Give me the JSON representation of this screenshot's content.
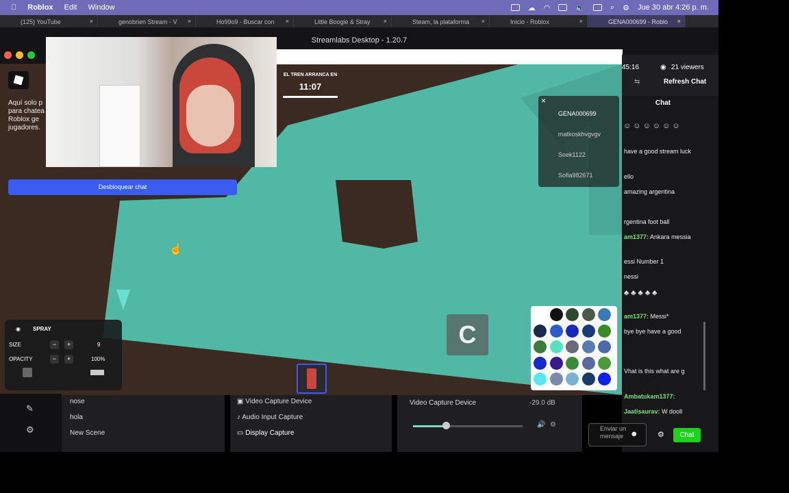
{
  "menubar": {
    "app_name": "Roblox",
    "edit": "Edit",
    "window": "Window",
    "datetime": "Jue 30 abr  4:26 p. m."
  },
  "browser_tabs": [
    {
      "label": "(125) YouTube"
    },
    {
      "label": "genobrien Stream - V"
    },
    {
      "label": "Ho99o9 - Buscar con"
    },
    {
      "label": "Little Boogie & Stray"
    },
    {
      "label": "Steam, la plataforma"
    },
    {
      "label": "Inicio - Roblox"
    },
    {
      "label": "GENA000699 - Roblo"
    }
  ],
  "streamlabs": {
    "title": "Streamlabs Desktop - 1.20.7"
  },
  "roblox_side": {
    "text1": "Aquí solo p",
    "text2": "para chatea",
    "text3": "Roblox ge",
    "text4": "jugadores.",
    "unlock_chat": "Desbloquear chat"
  },
  "timer": {
    "label": "EL TREN ARRANCA EN",
    "value": "11:07"
  },
  "players": [
    "GENA000699",
    "matkoskhvgvgv",
    "Soek1122",
    "Sofia982671"
  ],
  "spray_panel": {
    "title": "SPRAY",
    "size_label": "SIZE",
    "size_value": "9",
    "opacity_label": "OPACITY",
    "opacity_value": "100%",
    "minus": "−",
    "plus": "+"
  },
  "key_hint": "C",
  "palette_colors": [
    "#ffffff",
    "#111111",
    "#2d4a2d",
    "#4a5a4a",
    "#3a7ab5",
    "#1a2a4a",
    "#2e5cc8",
    "#1a2ab8",
    "#1a3a7a",
    "#3a8a2a",
    "#3a7a3a",
    "#5ae0c0",
    "#6a6a7a",
    "#5a7ab0",
    "#4a6aa8",
    "#1a28c8",
    "#3a1a8a",
    "#3a8a3a",
    "#5a6aa0",
    "#4a9a3a",
    "#5ae8f0",
    "#7a8aaa",
    "#7ab0d0",
    "#1a3a6a",
    "#1020e8"
  ],
  "scenes": [
    "nose",
    "hola",
    "New Scene"
  ],
  "sources": [
    "Video Capture Device",
    "Audio Input Capture",
    "Display Capture"
  ],
  "mixer": {
    "device": "Video Capture Device",
    "db": "-29.0 dB",
    "level": 0.3
  },
  "chat": {
    "elapsed": "45:16",
    "viewers": "21 viewers",
    "refresh": "Refresh Chat",
    "tab": "Chat",
    "messages": [
      {
        "name": "",
        "text": "have a good stream luck"
      },
      {
        "name": "",
        "text": "ello"
      },
      {
        "name": "",
        "text": "amazing argentina"
      },
      {
        "name": "",
        "text": "rgentina foot ball"
      },
      {
        "name": "am1377:",
        "text": "Ankara messia"
      },
      {
        "name": "",
        "text": "essi Number 1"
      },
      {
        "name": "",
        "text": "nessi"
      },
      {
        "name": "am1377:",
        "text": "Messi*"
      },
      {
        "name": "",
        "text": "bye bye have a good"
      },
      {
        "name": "",
        "text": "Vhat is this what are g"
      },
      {
        "name": "Ambatukam1377:",
        "text": ""
      },
      {
        "name": "Jaatisaurav:",
        "text": "W dooll"
      }
    ],
    "input_placeholder": "Enviar un mensaje",
    "send": "Chat"
  }
}
